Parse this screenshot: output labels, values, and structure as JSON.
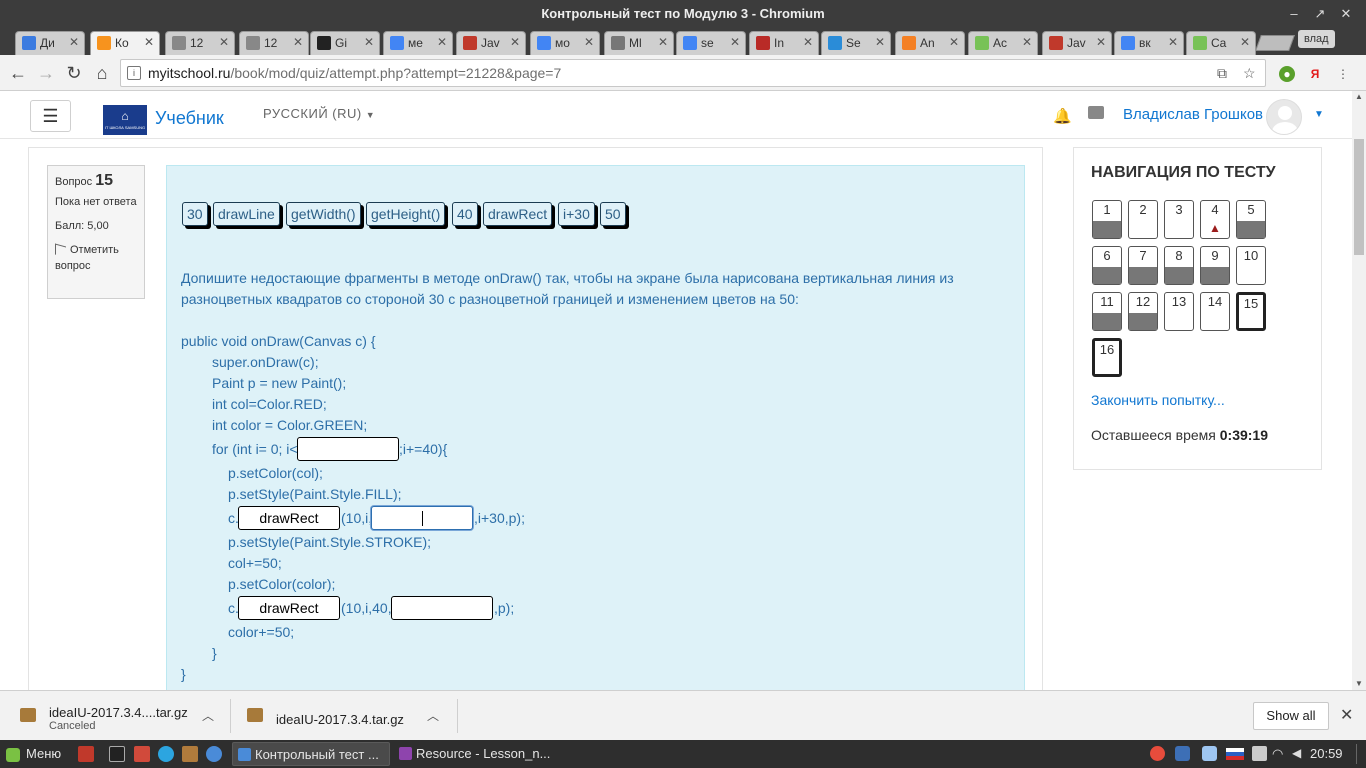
{
  "window": {
    "title": "Контрольный тест по Модулю 3 - Chromium",
    "minimize": "–",
    "maximize": "↗",
    "close": "✕"
  },
  "tabs": [
    {
      "label": "Ди",
      "icon": "chat-icon",
      "color": "#3b7be0"
    },
    {
      "label": "Ко",
      "icon": "moodle-icon",
      "color": "#f7931e"
    },
    {
      "label": "12",
      "icon": "document-icon",
      "color": "#888888"
    },
    {
      "label": "12",
      "icon": "document-icon",
      "color": "#888888"
    },
    {
      "label": "Gi",
      "icon": "github-icon",
      "color": "#222222"
    },
    {
      "label": "ме",
      "icon": "google-icon",
      "color": "#4285f4"
    },
    {
      "label": "Jav",
      "icon": "paw-icon",
      "color": "#c0392b"
    },
    {
      "label": "мо",
      "icon": "google-icon",
      "color": "#4285f4"
    },
    {
      "label": "Ml",
      "icon": "mail-icon",
      "color": "#777777"
    },
    {
      "label": "se",
      "icon": "google-icon",
      "color": "#4285f4"
    },
    {
      "label": "In",
      "icon": "quora-icon",
      "color": "#b92b27"
    },
    {
      "label": "Se",
      "icon": "x-circle-icon",
      "color": "#2a8cd8"
    },
    {
      "label": "An",
      "icon": "stackoverflow-icon",
      "color": "#f48024"
    },
    {
      "label": "Ac",
      "icon": "android-icon",
      "color": "#78c257"
    },
    {
      "label": "Jav",
      "icon": "paw-icon",
      "color": "#c0392b"
    },
    {
      "label": "вк",
      "icon": "google-icon",
      "color": "#4285f4"
    },
    {
      "label": "Ca",
      "icon": "android-icon",
      "color": "#78c257"
    }
  ],
  "profile": "влад",
  "toolbar": {
    "url_host": "myitschool.ru",
    "url_path": "/book/mod/quiz/attempt.php?attempt=21228&page=7"
  },
  "navbar": {
    "site_name": "Учебник",
    "logo_text": "IT ШКОЛА SAMSUNG",
    "language": "РУССКИЙ (RU)",
    "user_name": "Владислав Грошков",
    "menu_glyph": "☰",
    "logo_glyph": "⌂"
  },
  "question_info": {
    "label": "Вопрос",
    "number": "15",
    "status": "Пока нет ответа",
    "grade": "Балл: 5,00",
    "flag": "Отметить вопрос"
  },
  "drag_items": [
    "30",
    "drawLine",
    "getWidth()",
    "getHeight()",
    "40",
    "drawRect",
    "i+30",
    "50"
  ],
  "question": {
    "text_line1": "Допишите недостающие фрагменты в методе onDraw() так, чтобы на экране была нарисована вертикальная линия из",
    "text_line2": "разноцветных квадратов со стороной 30  с разноцветной границей  и изменением цветов на 50:",
    "code": {
      "l1": "public void onDraw(Canvas c) {",
      "l2": "super.onDraw(c);",
      "l3": "Paint p = new Paint();",
      "l4": "int col=Color.RED;",
      "l5": "int color = Color.GREEN;",
      "l6a": "for (int i= 0; i<",
      "l6b": ";i+=40){",
      "l7": "p.setColor(col);",
      "l8": "p.setStyle(Paint.Style.FILL);",
      "l9a": "c.",
      "l9b": "(10,i,",
      "l9c": ",i+30,p);",
      "l10": "p.setStyle(Paint.Style.STROKE);",
      "l11": "col+=50;",
      "l12": "p.setColor(color);",
      "l13a": "c.",
      "l13b": "(10,i,40,",
      "l13c": ",p);",
      "l14": "color+=50;",
      "l15": "}",
      "l16": "}"
    },
    "blanks": {
      "b1": "",
      "b2": "drawRect",
      "b3": "",
      "b4": "drawRect",
      "b5": ""
    }
  },
  "quiz_nav": {
    "title": "НАВИГАЦИЯ ПО ТЕСТУ",
    "buttons": [
      {
        "n": "1",
        "state": "answered"
      },
      {
        "n": "2",
        "state": "empty"
      },
      {
        "n": "3",
        "state": "empty"
      },
      {
        "n": "4",
        "state": "flagged"
      },
      {
        "n": "5",
        "state": "answered"
      },
      {
        "n": "6",
        "state": "answered"
      },
      {
        "n": "7",
        "state": "answered"
      },
      {
        "n": "8",
        "state": "answered"
      },
      {
        "n": "9",
        "state": "answered"
      },
      {
        "n": "10",
        "state": "empty"
      },
      {
        "n": "11",
        "state": "answered"
      },
      {
        "n": "12",
        "state": "answered"
      },
      {
        "n": "13",
        "state": "empty"
      },
      {
        "n": "14",
        "state": "empty"
      },
      {
        "n": "15",
        "state": "current"
      },
      {
        "n": "16",
        "state": "current"
      }
    ],
    "finish_link": "Закончить попытку...",
    "timer_label": "Оставшееся время",
    "timer_value": "0:39:19"
  },
  "downloads": {
    "item1_name": "ideaIU-2017.3.4....tar.gz",
    "item1_status": "Canceled",
    "item2_name": "ideaIU-2017.3.4.tar.gz",
    "show_all": "Show all"
  },
  "taskbar": {
    "menu": "Меню",
    "task1": "Контрольный тест ...",
    "task2": "Resource - Lesson_n...",
    "clock": "20:59"
  }
}
